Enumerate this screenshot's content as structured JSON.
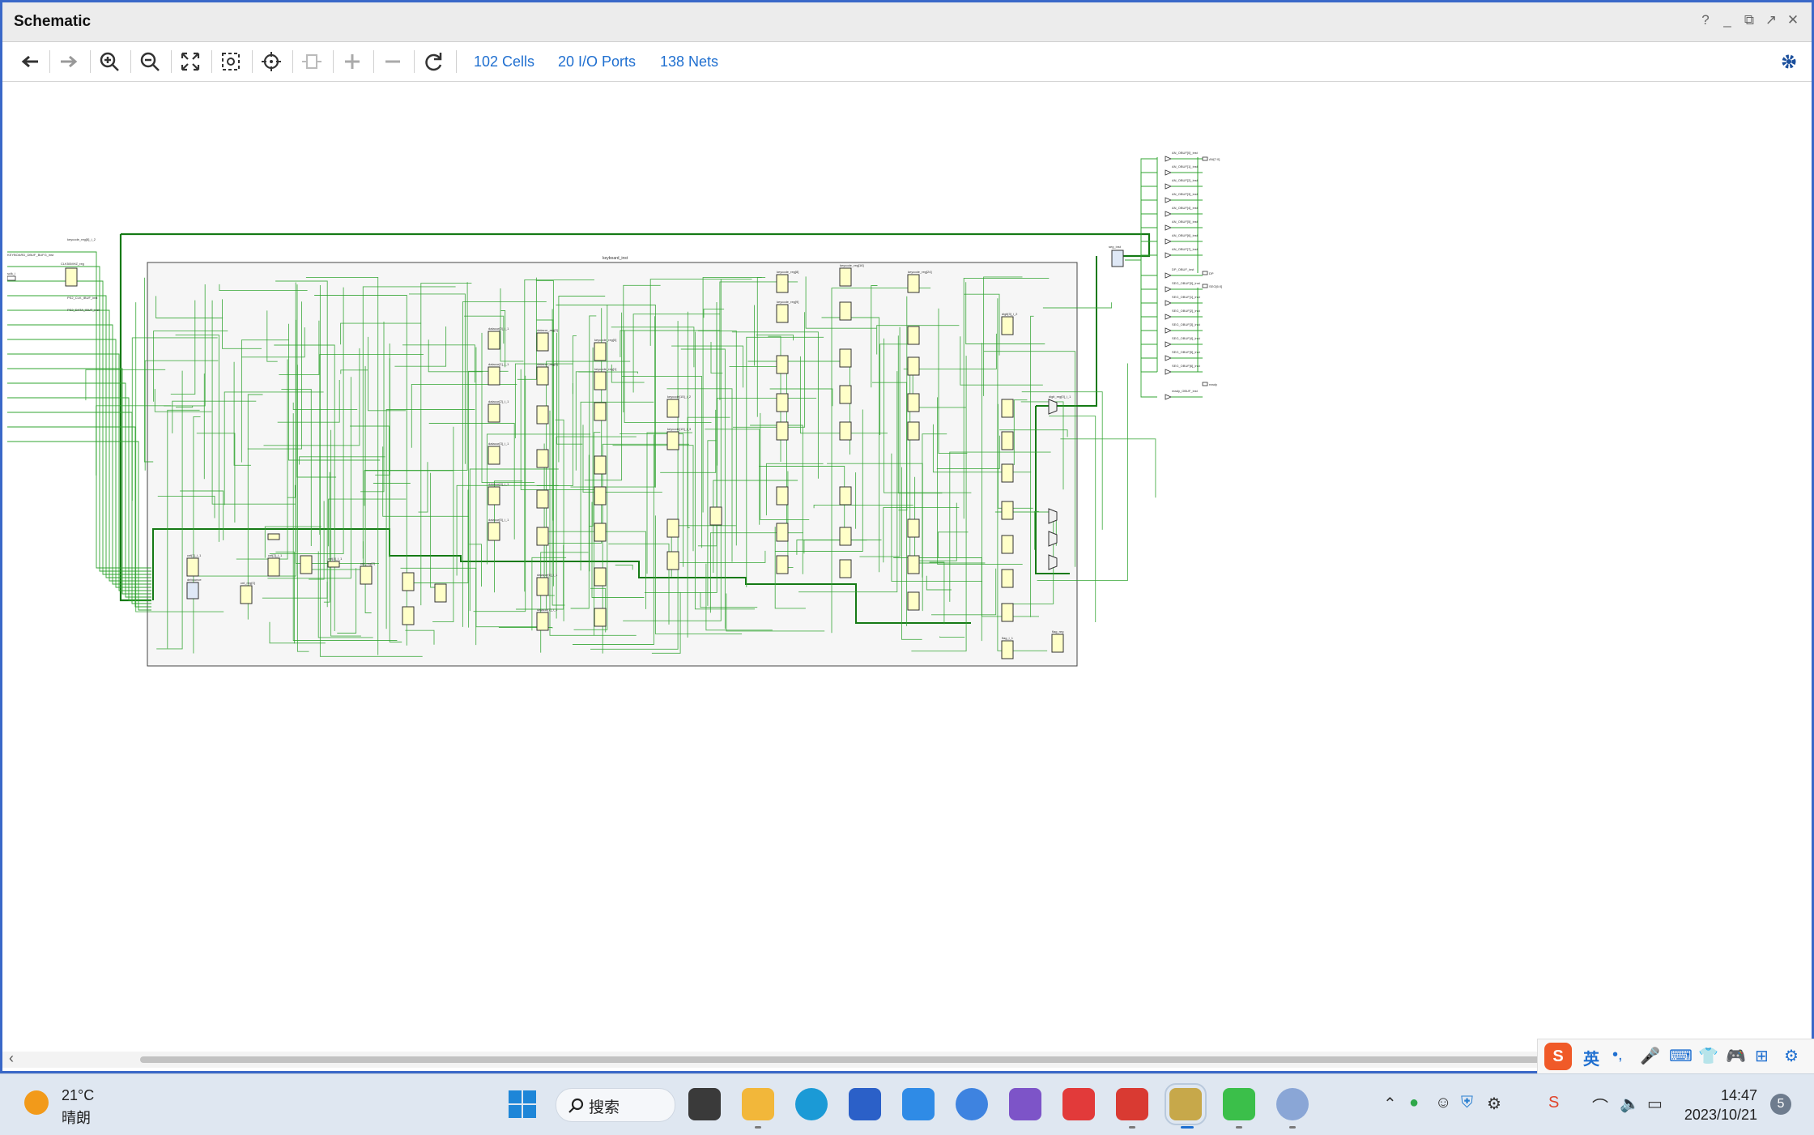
{
  "window": {
    "title": "Schematic"
  },
  "toolbar": {
    "cells": "102 Cells",
    "ports": "20 I/O Ports",
    "nets": "138 Nets"
  },
  "schematic": {
    "top_instance": "keyboard_inst",
    "left_ports": [
      "KEYBOARD_DBUF_BUFG_inst",
      "sclk_i",
      "PS2_CLK_IBUF_inst",
      "PS2_DATA_IBUF_inst",
      "keycode_reg[8]_i_2",
      "CLK50MHZ_reg"
    ],
    "inner_blocks": [
      "cnt[1]_i_1",
      "debounce",
      "cnt[2]_i_1",
      "cnt_reg[0]",
      "cnt[4]_i_1",
      "cnt_reg[2]",
      "datacur[0]_i_1",
      "datacur[1]_i_1",
      "datacur[2]_i_1",
      "datacur[3]_i_1",
      "datacur[4]_i_1",
      "datacur[5]_i_1",
      "datacur[6]_i_1",
      "datacur[7]_i_1",
      "datacur_reg[0]",
      "datacur_reg[1]",
      "keycode_reg[0]",
      "keycode_reg[1]",
      "keycode[15]_i_2",
      "keycode[15]_i_3",
      "keycode_reg[8]",
      "keycode_reg[9]",
      "keycode_reg[16]",
      "keycode_reg[24]",
      "digit[3]_i_2",
      "digit_reg[0]_i_1",
      "flag_i_1",
      "flag_reg"
    ],
    "right_ports": [
      "seg_inst",
      "AN[7:0]",
      "DP",
      "SEG[6:0]",
      "ready"
    ],
    "right_buffers": [
      "AN_OBUF[0]_inst",
      "AN_OBUF[1]_inst",
      "AN_OBUF[2]_inst",
      "AN_OBUF[3]_inst",
      "AN_OBUF[4]_inst",
      "AN_OBUF[5]_inst",
      "AN_OBUF[6]_inst",
      "AN_OBUF[7]_inst",
      "DP_OBUF_inst",
      "SEG_OBUF[0]_inst",
      "SEG_OBUF[1]_inst",
      "SEG_OBUF[2]_inst",
      "SEG_OBUF[3]_inst",
      "SEG_OBUF[4]_inst",
      "SEG_OBUF[5]_inst",
      "SEG_OBUF[6]_inst",
      "ready_OBUF_inst"
    ]
  },
  "ime": {
    "lang": "英"
  },
  "taskbar": {
    "weather_temp": "21°C",
    "weather_desc": "晴朗",
    "search_label": "搜索",
    "time": "14:47",
    "date": "2023/10/21",
    "badge": "5"
  },
  "icons": [
    "back-icon",
    "forward-icon",
    "zoom-in-icon",
    "zoom-out-icon",
    "fit-icon",
    "zoom-area-icon",
    "locate-icon",
    "expand-icon",
    "plus-icon",
    "minus-icon",
    "refresh-icon",
    "gear-icon"
  ]
}
